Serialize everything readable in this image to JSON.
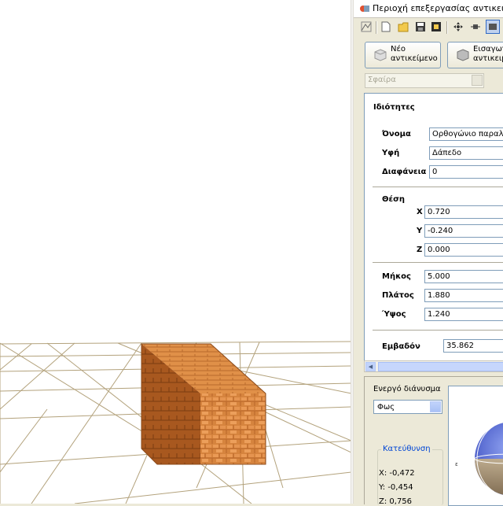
{
  "window": {
    "title": "Περιοχή επεξεργασίας αντικειμένων"
  },
  "toolbar": {
    "icons": [
      "scene-icon",
      "new-file-icon",
      "open-folder-icon",
      "save-icon",
      "export-icon",
      "move-icon",
      "resize-icon",
      "view-icon"
    ]
  },
  "buttons": {
    "new_object": "Νέο\nαντικείμενο",
    "import_object": "Εισαγωγή\nαντικειμέ"
  },
  "shape_select": {
    "value": "Σφαίρα"
  },
  "properties": {
    "heading": "Ιδιότητες",
    "name_label": "Όνομα",
    "name_value": "Ορθογώνιο παραλληλ",
    "texture_label": "Υφή",
    "texture_value": "Δάπεδο",
    "transparency_label": "Διαφάνεια",
    "transparency_value": "0",
    "position_label": "Θέση",
    "x_label": "X",
    "x_value": "0.720",
    "y_label": "Y",
    "y_value": "-0.240",
    "z_label": "Z",
    "z_value": "0.000",
    "length_label": "Μήκος",
    "length_value": "5.000",
    "width_label": "Πλάτος",
    "width_value": "1.880",
    "height_label": "Ύψος",
    "height_value": "1.240",
    "area_label": "Εμβαδόν",
    "area_value": "35.862"
  },
  "lower": {
    "active_vector_label": "Ενεργό διάνυσμα",
    "vector_select": "Φως",
    "direction_group": "Κατεύθυνση",
    "x": "X: -0,472",
    "y": "Y: -0,454",
    "z": "Z: 0,756"
  },
  "colors": {
    "panel_bg": "#ece9d8",
    "border_blue": "#7f9db9",
    "brick_orange": "#d98a45",
    "grid_line": "#b0a07a"
  }
}
